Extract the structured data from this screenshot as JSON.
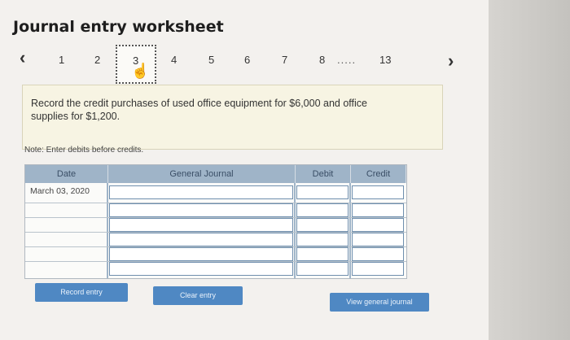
{
  "header": {
    "title": "Journal entry worksheet"
  },
  "pagination": {
    "pages": [
      "1",
      "2",
      "3",
      "4",
      "5",
      "6",
      "7",
      "8",
      "13"
    ],
    "active": "3",
    "ellipsis": "....."
  },
  "prompt": {
    "text": "Record the credit purchases of used office equipment for $6,000 and office supplies for $1,200."
  },
  "note": "Note: Enter debits before credits.",
  "journal": {
    "headers": {
      "date": "Date",
      "account": "General Journal",
      "debit": "Debit",
      "credit": "Credit"
    },
    "rows": [
      {
        "date": "March 03, 2020",
        "account": "",
        "debit": "",
        "credit": ""
      }
    ]
  },
  "buttons": {
    "record": "Record entry",
    "clear": "Clear entry",
    "view": "View general journal"
  },
  "colors": {
    "header_bg": "#9fb4c8",
    "button_bg": "#4f88c3",
    "prompt_bg": "#f7f4e3"
  }
}
